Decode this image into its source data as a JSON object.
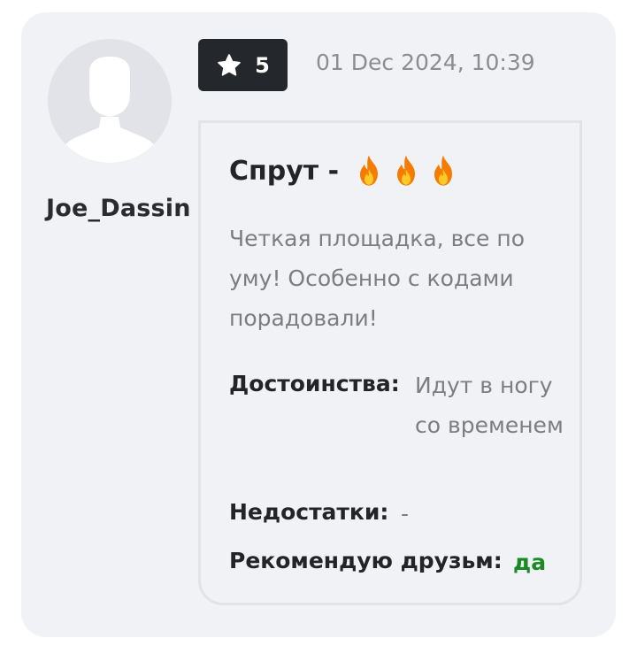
{
  "user": {
    "name": "Joe_Dassin",
    "avatar_icon": "user-silhouette-icon"
  },
  "rating": {
    "value": "5",
    "icon": "star-icon"
  },
  "date": "01 Dec 2024, 10:39",
  "review": {
    "title": "Спрут -",
    "title_icons": [
      "fire-icon",
      "fire-icon",
      "fire-icon"
    ],
    "text": "Четкая площадка, все по уму! Особенно с кодами порадовали!",
    "pros_label": "Достоинства:",
    "pros_value": "Идут в ногу со временем",
    "cons_label": "Недостатки:",
    "cons_value": "-",
    "recommend_label": "Рекомендую друзьм:",
    "recommend_value": "да"
  },
  "colors": {
    "card_bg": "#f1f2f6",
    "badge_bg": "#24272b",
    "recommend_yes": "#1a8a24",
    "flame_orange": "#f57c00",
    "flame_yellow": "#ffca28"
  }
}
